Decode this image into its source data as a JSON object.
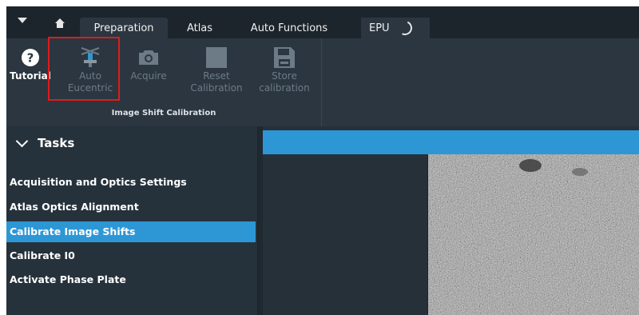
{
  "tabs": [
    {
      "label": "Preparation",
      "active": true
    },
    {
      "label": "Atlas",
      "active": false
    },
    {
      "label": "Auto Functions",
      "active": false
    }
  ],
  "epu_tab": {
    "label": "EPU"
  },
  "ribbon": {
    "buttons": [
      {
        "label": "Tutorial",
        "icon": "help-icon",
        "enabled": true
      },
      {
        "label": "Auto\nEucentric",
        "icon": "eucentric-icon",
        "enabled": false
      },
      {
        "label": "Acquire",
        "icon": "camera-icon",
        "enabled": false
      },
      {
        "label": "Reset\nCalibration",
        "icon": "reset-icon",
        "enabled": false
      },
      {
        "label": "Store\ncalibration",
        "icon": "save-icon",
        "enabled": false
      }
    ],
    "group_label": "Image Shift Calibration"
  },
  "tasks": {
    "header": "Tasks",
    "items": [
      {
        "label": "Acquisition and Optics Settings",
        "selected": false
      },
      {
        "label": "Atlas Optics Alignment",
        "selected": false
      },
      {
        "label": "Calibrate Image Shifts",
        "selected": true
      },
      {
        "label": "Calibrate I0",
        "selected": false
      },
      {
        "label": "Activate Phase Plate",
        "selected": false
      }
    ]
  },
  "colors": {
    "accent": "#2d97d6",
    "highlight": "#e01b1b",
    "background": "#253038"
  }
}
